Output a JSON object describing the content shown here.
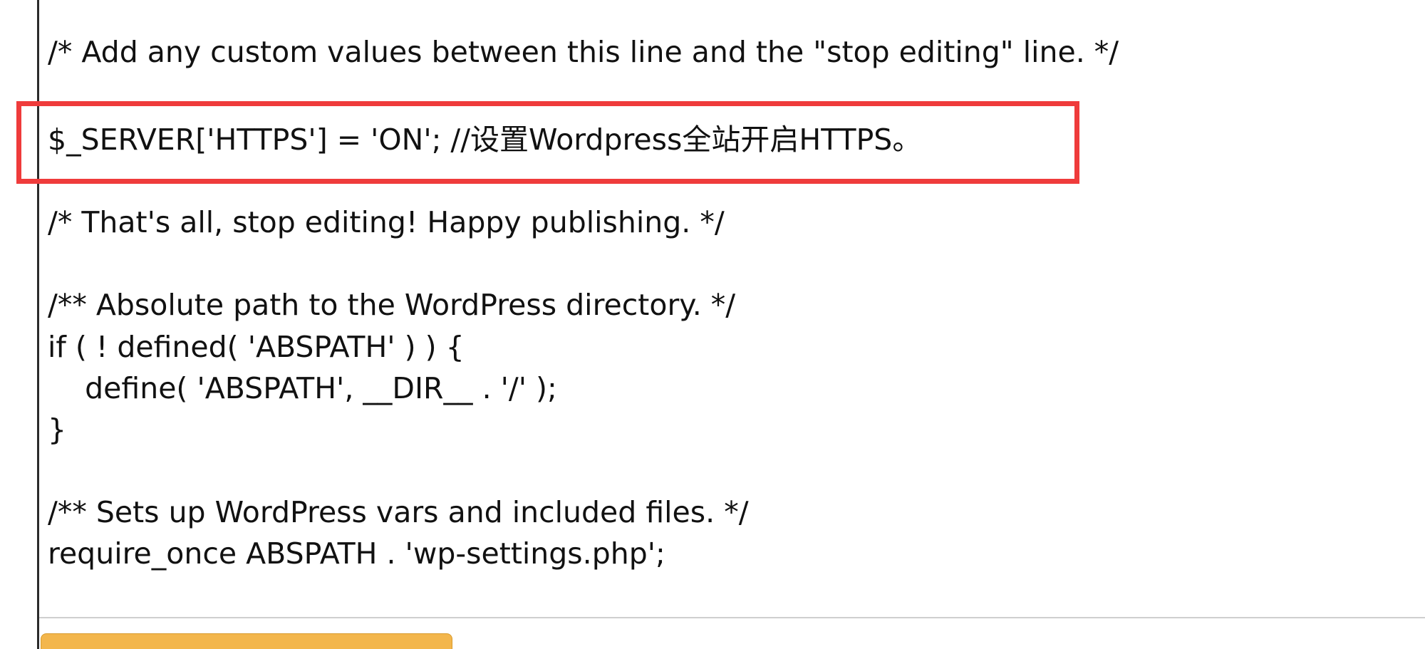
{
  "editor": {
    "lines": {
      "l1": "/* Add any custom values between this line and the \"stop editing\" line. */",
      "l2": "$_SERVER['HTTPS'] = 'ON'; //设置Wordpress全站开启HTTPS。",
      "l3": "/* That's all, stop editing! Happy publishing. */",
      "l4": "/** Absolute path to the WordPress directory. */",
      "l5": "if ( ! defined( 'ABSPATH' ) ) {",
      "l6": "\tdefine( 'ABSPATH', __DIR__ . '/' );",
      "l7": "}",
      "l8": "/** Sets up WordPress vars and included files. */",
      "l9": "require_once ABSPATH . 'wp-settings.php';"
    }
  },
  "colors": {
    "highlight": "#ef3b3b",
    "button": "#f3b64c",
    "text": "#111111"
  }
}
